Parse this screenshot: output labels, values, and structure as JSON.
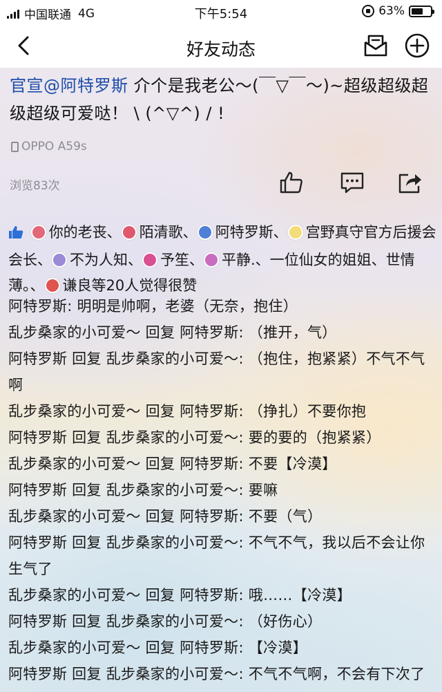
{
  "status_bar": {
    "carrier": "中国联通",
    "network": "4G",
    "time": "下午5:54",
    "battery_text": "63%",
    "battery_level": 0.63
  },
  "nav": {
    "title": "好友动态",
    "back_icon": "chevron-left-icon",
    "message_icon": "envelope-icon",
    "add_icon": "plus-circle-icon"
  },
  "post": {
    "mention": "官宣@阿特罗斯",
    "text": "  介个是我老公～(￣▽￣～)~超级超级超级超级可爱哒！ \\ (^▽^) / !",
    "device": "OPPO A59s",
    "views": "浏览83次",
    "actions": [
      "thumbs-up-icon",
      "comment-icon",
      "share-icon"
    ]
  },
  "likes": {
    "names": [
      {
        "name": "你的老丧、",
        "avatar_color": "#e2687a"
      },
      {
        "name": "陌清歌、",
        "avatar_color": "#e0586e"
      },
      {
        "name": "阿特罗斯、",
        "avatar_color": "#4f7fd6"
      },
      {
        "name": "宫野真守官方后援会会长、",
        "avatar_color": "#f3dc7a"
      },
      {
        "name": "不为人知、",
        "avatar_color": "#9b8ad8"
      },
      {
        "name": "予笙、",
        "avatar_color": "#d8508f"
      },
      {
        "name": "平静.、一位仙女的姐姐、世情薄。、",
        "avatar_color": "#c96cc0"
      },
      {
        "name": "谦良等20人觉得很赞",
        "avatar_color": "#e0534f"
      }
    ]
  },
  "comments": [
    {
      "author": "阿特罗斯",
      "text": "阿特罗斯: 明明是帅啊，老婆（无奈，抱住）"
    },
    {
      "author": "乱步桑家的小可爱～",
      "text": "乱步桑家的小可爱～ 回复 阿特罗斯: （推开，气）"
    },
    {
      "author": "阿特罗斯",
      "text": "阿特罗斯 回复 乱步桑家的小可爱～: （抱住，抱紧紧）不气不气啊"
    },
    {
      "author": "乱步桑家的小可爱～",
      "text": "乱步桑家的小可爱～ 回复 阿特罗斯: （挣扎）不要你抱"
    },
    {
      "author": "阿特罗斯",
      "text": "阿特罗斯 回复 乱步桑家的小可爱～: 要的要的（抱紧紧）"
    },
    {
      "author": "乱步桑家的小可爱～",
      "text": "乱步桑家的小可爱～ 回复 阿特罗斯: 不要【冷漠】"
    },
    {
      "author": "阿特罗斯",
      "text": "阿特罗斯 回复 乱步桑家的小可爱～: 要嘛"
    },
    {
      "author": "乱步桑家的小可爱～",
      "text": "乱步桑家的小可爱～ 回复 阿特罗斯: 不要（气）"
    },
    {
      "author": "阿特罗斯",
      "text": "阿特罗斯 回复 乱步桑家的小可爱～: 不气不气，我以后不会让你生气了"
    },
    {
      "author": "乱步桑家的小可爱～",
      "text": "乱步桑家的小可爱～ 回复 阿特罗斯: 哦……【冷漠】"
    },
    {
      "author": "阿特罗斯",
      "text": "阿特罗斯 回复 乱步桑家的小可爱～: （好伤心）"
    },
    {
      "author": "乱步桑家的小可爱～",
      "text": "乱步桑家的小可爱～ 回复 阿特罗斯: 【冷漠】"
    },
    {
      "author": "阿特罗斯",
      "text": "阿特罗斯 回复 乱步桑家的小可爱～: 不气不气啊，不会有下次了"
    }
  ]
}
